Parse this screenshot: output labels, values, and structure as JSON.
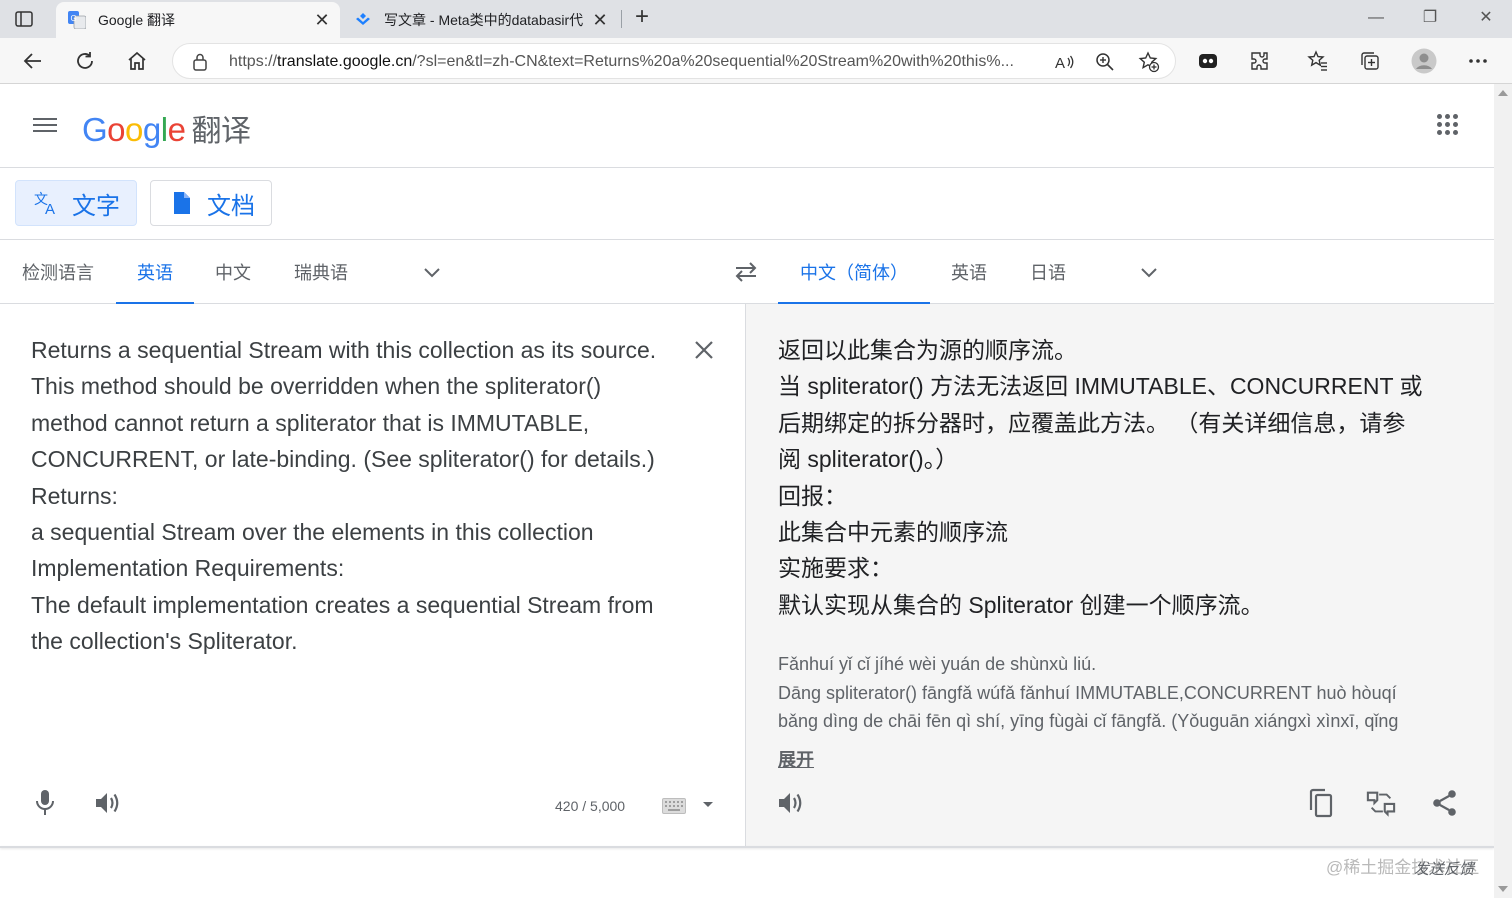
{
  "browser": {
    "tabs": [
      {
        "title": "Google 翻译",
        "active": true
      },
      {
        "title": "写文章 - Meta类中的databasir代",
        "active": false
      }
    ],
    "address": {
      "url_prefix": "https://",
      "url_host": "translate.google.cn",
      "url_rest": "/?sl=en&tl=zh-CN&text=Returns%20a%20sequential%20Stream%20with%20this%..."
    }
  },
  "header": {
    "logo_letters": [
      "G",
      "o",
      "o",
      "g",
      "l",
      "e"
    ],
    "product_name": "翻译"
  },
  "modes": [
    {
      "label": "文字",
      "active": true
    },
    {
      "label": "文档",
      "active": false
    }
  ],
  "source_languages": [
    {
      "label": "检测语言",
      "selected": false
    },
    {
      "label": "英语",
      "selected": true
    },
    {
      "label": "中文",
      "selected": false
    },
    {
      "label": "瑞典语",
      "selected": false
    }
  ],
  "target_languages": [
    {
      "label": "中文（简体）",
      "selected": true
    },
    {
      "label": "英语",
      "selected": false
    },
    {
      "label": "日语",
      "selected": false
    }
  ],
  "source": {
    "lines": [
      "Returns a sequential Stream with this collection as its source.",
      "This method should be overridden when the spliterator()",
      "method cannot return a spliterator that is IMMUTABLE,",
      "CONCURRENT, or late-binding. (See spliterator() for details.)",
      "Returns:",
      "a sequential Stream over the elements in this collection",
      "Implementation Requirements:",
      "The default implementation creates a sequential Stream from",
      "the collection's Spliterator."
    ],
    "char_count": "420 / 5,000"
  },
  "target": {
    "lines": [
      "返回以此集合为源的顺序流。",
      "当 spliterator() 方法无法返回 IMMUTABLE、CONCURRENT 或",
      "后期绑定的拆分器时，应覆盖此方法。 （有关详细信息，请参",
      "阅 spliterator()。）",
      "回报：",
      "此集合中元素的顺序流",
      "实施要求：",
      "默认实现从集合的 Spliterator 创建一个顺序流。"
    ],
    "transliteration": [
      "Fǎnhuí yǐ cǐ jíhé wèi yuán de shùnxù liú.",
      "Dāng spliterator() fāngfǎ wúfǎ fǎnhuí IMMUTABLE,CONCURRENT huò hòuqí",
      "bǎng dìng de chāi fēn qì shí, yīng fùgài cǐ fāngfǎ. (Yǒuguān xiángxì xìnxī, qǐng"
    ],
    "expand_label": "展开"
  },
  "footer": {
    "watermark": "@稀土掘金技术社区",
    "feedback": "发送反馈"
  },
  "colors": {
    "accent": "#1a73e8",
    "accent_bg": "#e8f0fe",
    "text_secondary": "#5f6368"
  }
}
